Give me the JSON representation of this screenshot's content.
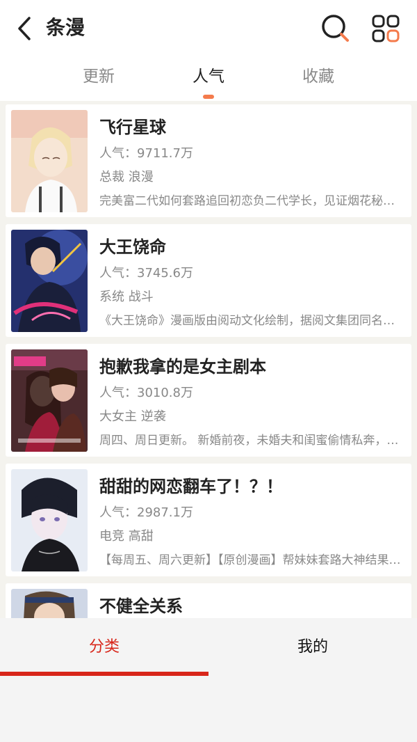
{
  "header": {
    "title": "条漫",
    "tabs": [
      {
        "label": "更新"
      },
      {
        "label": "人气"
      },
      {
        "label": "收藏"
      }
    ],
    "active_tab": "人气"
  },
  "colors": {
    "accent_orange": "#f47b4c",
    "bottom_active_red": "#d8261a"
  },
  "icons": [
    "back-icon",
    "search-icon",
    "grid-menu-icon"
  ],
  "comics": [
    {
      "title": "飞行星球",
      "popularity": "人气：9711.7万",
      "tags": "总裁 浪漫",
      "description": "完美富二代如何套路追回初恋负二代学长，见证烟花秘密，甜宠爱情故事"
    },
    {
      "title": "大王饶命",
      "popularity": "人气：3745.6万",
      "tags": "系统 战斗",
      "description": "《大王饶命》漫画版由阅动文化绘制，据阅文集团同名小说改编"
    },
    {
      "title": "抱歉我拿的是女主剧本",
      "popularity": "人气：3010.8万",
      "tags": "大女主 逆袭",
      "description": "周四、周日更新。 新婚前夜，未婚夫和闺蜜偷情私奔，她被推下高楼"
    },
    {
      "title": "甜甜的网恋翻车了！？！",
      "popularity": "人气：2987.1万",
      "tags": "电竞 高甜",
      "description": "【每周五、周六更新】【原创漫画】帮妹妹套路大神结果翻车"
    },
    {
      "title": "不健全关系",
      "popularity": "",
      "tags": "",
      "description": ""
    }
  ],
  "bottom_nav": [
    {
      "label": "分类"
    },
    {
      "label": "我的"
    }
  ]
}
